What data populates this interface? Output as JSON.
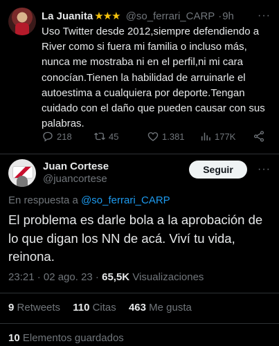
{
  "tweet_original": {
    "display_name": "La Juanita",
    "badge": "★★★",
    "handle": "@so_ferrari_CARP",
    "separator": "·",
    "time": "9h",
    "text": "Uso Twitter desde 2012,siempre defendiendo a River como si fuera mi familia o incluso más, nunca me mostraba ni en el perfil,ni mi cara conocían.Tienen la habilidad de arruinarle el autoestima a cualquiera por deporte.Tengan cuidado con el daño que pueden causar con sus palabras.",
    "actions": {
      "replies": "218",
      "retweets": "45",
      "likes": "1.381",
      "views": "177K"
    }
  },
  "tweet_reply": {
    "display_name": "Juan Cortese",
    "handle": "@juancortese",
    "follow_label": "Seguir",
    "reply_prefix": "En respuesta a",
    "reply_mention": "@so_ferrari_CARP",
    "text": "El problema es darle bola a la aprobación de lo que digan los NN de acá. Viví tu vida, reinona.",
    "timestamp": "23:21 · 02 ago. 23 ·",
    "views_count": "65,5K",
    "views_label": "Visualizaciones",
    "stats": {
      "retweets_count": "9",
      "retweets_label": "Retweets",
      "quotes_count": "110",
      "quotes_label": "Citas",
      "likes_count": "463",
      "likes_label": "Me gusta",
      "bookmarks_count": "10",
      "bookmarks_label": "Elementos guardados"
    }
  },
  "colors": {
    "background": "#000000",
    "text_primary": "#e7e9ea",
    "text_secondary": "#71767b",
    "accent": "#1d9bf0",
    "divider": "#2f3336",
    "star": "#f4c20d"
  },
  "icons": [
    "reply-icon",
    "retweet-icon",
    "like-icon",
    "views-icon",
    "share-icon",
    "more-icon"
  ]
}
